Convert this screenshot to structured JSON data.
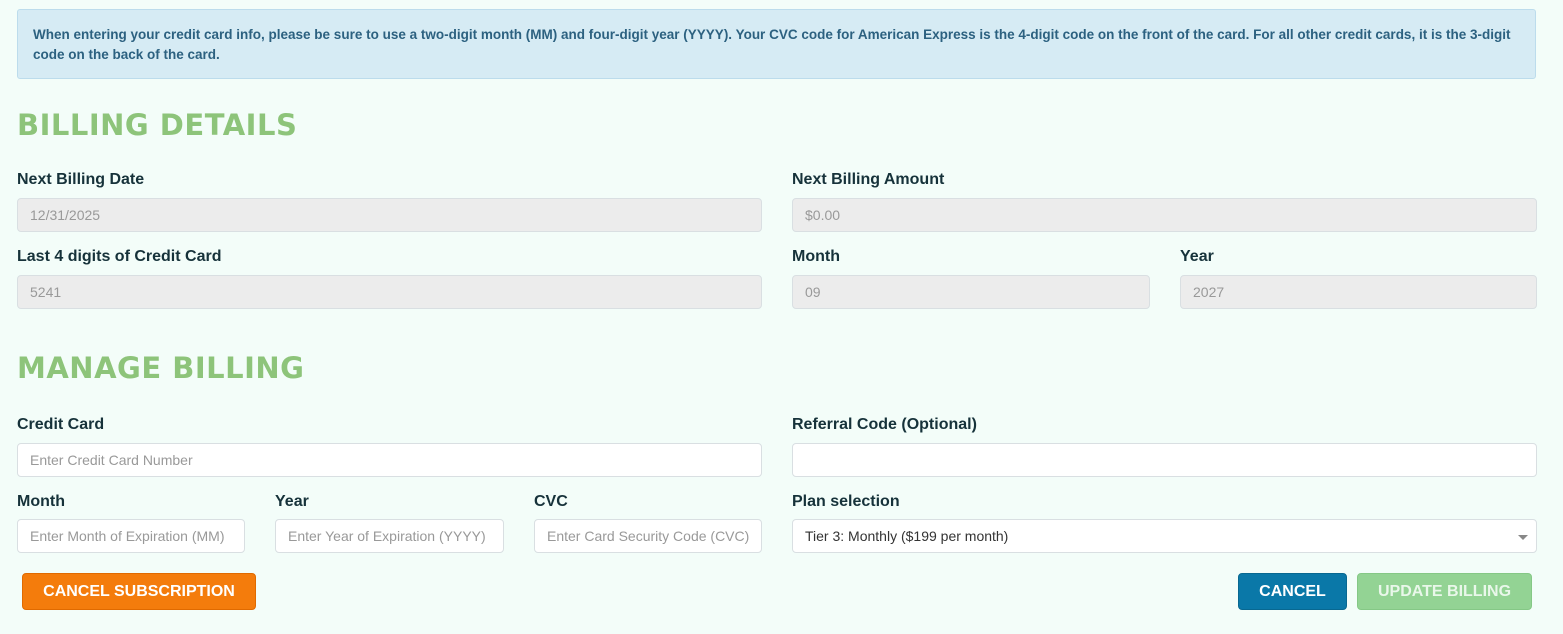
{
  "alert": {
    "text": "When entering your credit card info, please be sure to use a two-digit month (MM) and four-digit year (YYYY). Your CVC code for American Express is the 4-digit code on the front of the card. For all other credit cards, it is the 3-digit code on the back of the card."
  },
  "billing_details": {
    "title": "BILLING DETAILS",
    "next_billing_date_label": "Next Billing Date",
    "next_billing_date_value": "12/31/2025",
    "next_billing_amount_label": "Next Billing Amount",
    "next_billing_amount_value": "$0.00",
    "last4_label": "Last 4 digits of Credit Card",
    "last4_value": "5241",
    "month_label": "Month",
    "month_value": "09",
    "year_label": "Year",
    "year_value": "2027"
  },
  "manage_billing": {
    "title": "MANAGE BILLING",
    "credit_card_label": "Credit Card",
    "credit_card_placeholder": "Enter Credit Card Number",
    "referral_label": "Referral Code (Optional)",
    "referral_value": "",
    "month_label": "Month",
    "month_placeholder": "Enter Month of Expiration (MM)",
    "year_label": "Year",
    "year_placeholder": "Enter Year of Expiration (YYYY)",
    "cvc_label": "CVC",
    "cvc_placeholder": "Enter Card Security Code (CVC)",
    "plan_label": "Plan selection",
    "plan_selected": "Tier 3: Monthly ($199 per month)"
  },
  "actions": {
    "cancel_subscription": "CANCEL SUBSCRIPTION",
    "cancel": "CANCEL",
    "update_billing": "UPDATE BILLING"
  },
  "colors": {
    "section_title": "#8dc47a",
    "alert_bg": "#d6ebf4",
    "orange_button": "#f47c0c",
    "blue_button": "#0a78a8",
    "green_button_disabled": "#93d394"
  }
}
